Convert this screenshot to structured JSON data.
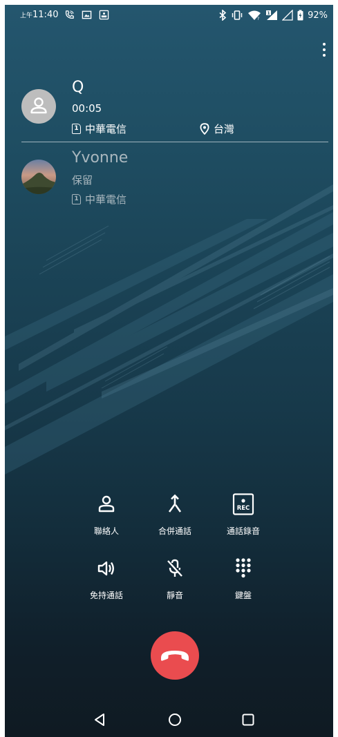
{
  "status_bar": {
    "ampm": "上午",
    "time": "11:40",
    "left_icons": [
      "wifi-calling-icon",
      "image-icon",
      "rec-icon"
    ],
    "right_icons": [
      "bluetooth-icon",
      "vibrate-icon",
      "wifi-icon",
      "signal-sim1-icon",
      "signal-sim2-icon",
      "battery-icon"
    ],
    "battery": "92%"
  },
  "active_call": {
    "name": "Q",
    "duration": "00:05",
    "sim_number": "1",
    "carrier": "中華電信",
    "location": "台灣"
  },
  "held_call": {
    "name": "Yvonne",
    "status": "保留",
    "sim_number": "1",
    "carrier": "中華電信"
  },
  "controls": {
    "contacts": "聯絡人",
    "merge": "合併通話",
    "record": "通話錄音",
    "speaker": "免持通話",
    "mute": "靜音",
    "keypad": "鍵盤"
  },
  "colors": {
    "end_call": "#ea4c4f",
    "held_text": "#a9b7be",
    "background_top": "#24566e",
    "background_bottom": "#0f1a22"
  },
  "nav_icons": [
    "back-icon",
    "home-icon",
    "recents-icon"
  ]
}
